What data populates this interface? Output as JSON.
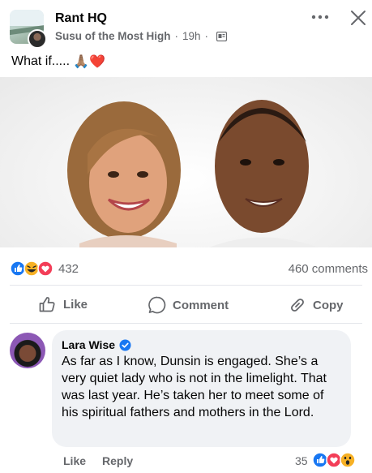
{
  "post": {
    "group_name": "Rant HQ",
    "author": "Susu of the Most High",
    "time": "19h",
    "separator": "·",
    "text": "What if.....",
    "emojis": "🙏🏽❤️",
    "icons": [
      "more-icon",
      "close-icon",
      "group-icon"
    ]
  },
  "stats": {
    "reactions_count": "432",
    "comments_count": "460 comments",
    "reaction_icons": [
      "like-icon",
      "haha-icon",
      "love-icon"
    ]
  },
  "actions": {
    "like": "Like",
    "comment": "Comment",
    "copy": "Copy"
  },
  "comment": {
    "author": "Lara Wise",
    "verified": true,
    "text": "As far as I know, Dunsin is engaged. She’s a very quiet lady who is not in the limelight. That was last year.  He’s taken her to meet some of his spiritual fathers and mothers in the Lord.",
    "like_label": "Like",
    "reply_label": "Reply",
    "reactions_count": "35",
    "reaction_icons": [
      "like-icon",
      "love-icon",
      "wow-icon"
    ]
  },
  "colors": {
    "accent": "#1877f2",
    "love": "#f33e58",
    "haha": "#f7b125",
    "secondary_text": "#65676b"
  }
}
